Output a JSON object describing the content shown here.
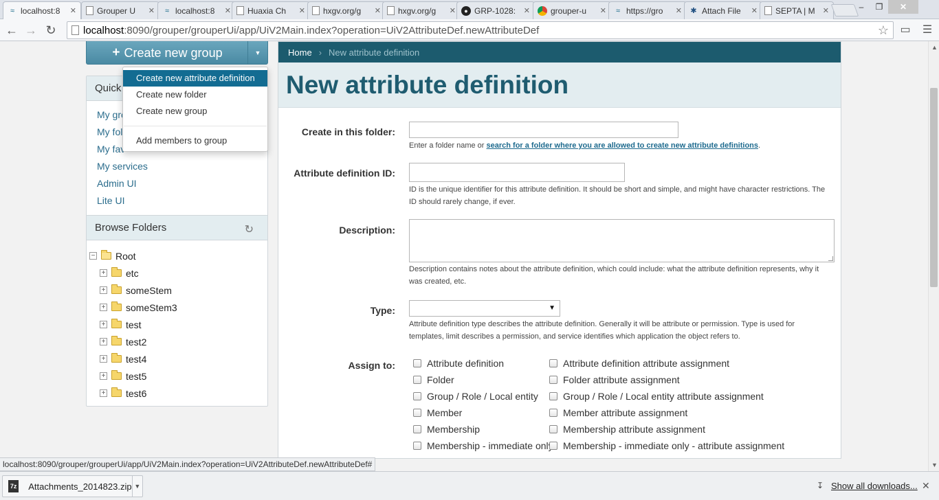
{
  "browser": {
    "tabs": [
      {
        "title": "localhost:8",
        "icon": "grouper",
        "active": true
      },
      {
        "title": "Grouper U",
        "icon": "page"
      },
      {
        "title": "localhost:8",
        "icon": "grouper"
      },
      {
        "title": "Huaxia Ch",
        "icon": "page"
      },
      {
        "title": "hxgv.org/g",
        "icon": "page"
      },
      {
        "title": "hxgv.org/g",
        "icon": "page"
      },
      {
        "title": "GRP-1028:",
        "icon": "github"
      },
      {
        "title": "grouper-u",
        "icon": "chrome"
      },
      {
        "title": "https://gro",
        "icon": "grouper"
      },
      {
        "title": "Attach File",
        "icon": "jira"
      },
      {
        "title": "SEPTA | M",
        "icon": "page"
      }
    ],
    "url_host": "localhost",
    "url_rest": ":8090/grouper/grouperUi/app/UiV2Main.index?operation=UiV2AttributeDef.newAttributeDef",
    "status_url": "localhost:8090/grouper/grouperUi/app/UiV2Main.index?operation=UiV2AttributeDef.newAttributeDef#"
  },
  "sidebar": {
    "create_button": "Create new group",
    "quick_title": "Quick",
    "quick_links": [
      "My gro",
      "My fold",
      "My fav",
      "My services",
      "Admin UI",
      "Lite UI"
    ],
    "browse_title": "Browse Folders",
    "tree": {
      "root": "Root",
      "children": [
        "etc",
        "someStem",
        "someStem3",
        "test",
        "test2",
        "test4",
        "test5",
        "test6"
      ]
    }
  },
  "dropdown": {
    "items": [
      "Create new attribute definition",
      "Create new folder",
      "Create new group"
    ],
    "extra_item": "Add members to group"
  },
  "breadcrumb": {
    "home": "Home",
    "separator": "›",
    "current": "New attribute definition"
  },
  "page_title": "New attribute definition",
  "form": {
    "folder_label": "Create in this folder:",
    "folder_help_prefix": "Enter a folder name or ",
    "folder_help_link": "search for a folder where you are allowed to create new attribute definitions",
    "folder_help_suffix": ".",
    "id_label": "Attribute definition ID:",
    "id_help": "ID is the unique identifier for this attribute definition. It should be short and simple, and might have character restrictions. The ID should rarely change, if ever.",
    "desc_label": "Description:",
    "desc_help": "Description contains notes about the attribute definition, which could include: what the attribute definition represents, why it was created, etc.",
    "type_label": "Type:",
    "type_value": "",
    "type_help": "Attribute definition type describes the attribute definition. Generally it will be attribute or permission. Type is used for templates, limit describes a permission, and service identifies which application the object refers to.",
    "assign_label": "Assign to:",
    "assign_left": [
      "Attribute definition",
      "Folder",
      "Group / Role / Local entity",
      "Member",
      "Membership",
      "Membership - immediate only"
    ],
    "assign_right": [
      "Attribute definition attribute assignment",
      "Folder attribute assignment",
      "Group / Role / Local entity attribute assignment",
      "Member attribute assignment",
      "Membership attribute assignment",
      "Membership - immediate only - attribute assignment"
    ]
  },
  "downloads": {
    "file_name": "Attachments_2014823.zip",
    "show_all": "Show all downloads..."
  }
}
